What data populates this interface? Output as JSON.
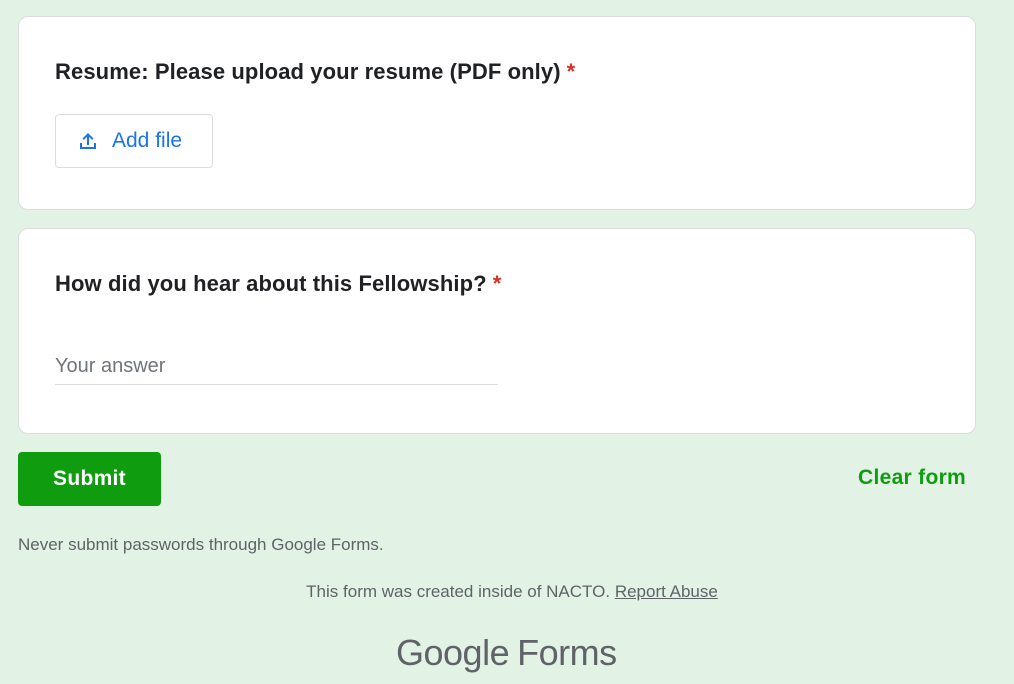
{
  "questions": [
    {
      "title": "Resume: Please upload your resume (PDF only)",
      "required_mark": "*",
      "add_file_label": "Add file"
    },
    {
      "title": "How did you hear about this Fellowship?",
      "required_mark": "*",
      "answer_placeholder": "Your answer",
      "answer_value": ""
    }
  ],
  "actions": {
    "submit_label": "Submit",
    "clear_label": "Clear form"
  },
  "footer": {
    "warning": "Never submit passwords through Google Forms.",
    "created_text": "This form was created inside of NACTO.",
    "report_link": "Report Abuse",
    "logo_brand": "Google",
    "logo_product": "Forms"
  },
  "colors": {
    "background": "#e2f3e6",
    "accent": "#0f9d0f",
    "link_blue": "#1a73e8",
    "required": "#d93025"
  },
  "icons": {
    "upload": "upload-icon"
  }
}
